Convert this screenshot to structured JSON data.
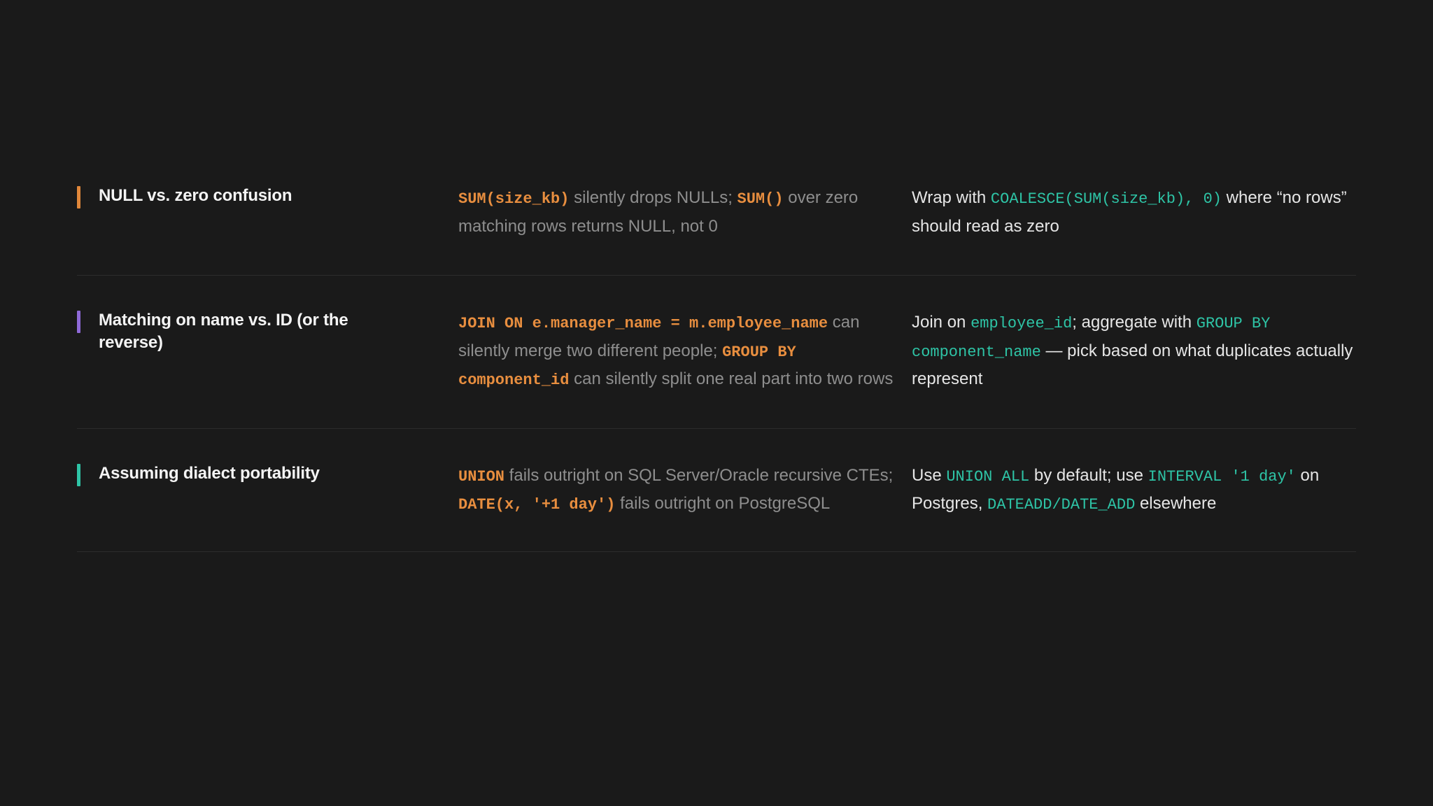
{
  "colors": {
    "background": "#1a1a1a",
    "divider": "#2c2c2c",
    "problem_code": "#e88e3f",
    "fix_code": "#2ec4a6",
    "problem_text": "#8e8e8e",
    "fix_text": "#e6e6e6"
  },
  "rows": [
    {
      "label": "NULL vs. zero confusion",
      "accent": "#e0873a",
      "problem": [
        {
          "t": "code",
          "v": "SUM(size_kb)"
        },
        {
          "t": "text",
          "v": " silently drops NULLs; "
        },
        {
          "t": "code",
          "v": "SUM()"
        },
        {
          "t": "text",
          "v": " over zero matching rows returns NULL, not 0"
        }
      ],
      "fix": [
        {
          "t": "text",
          "v": "Wrap with "
        },
        {
          "t": "code",
          "v": "COALESCE(SUM(size_kb), 0)"
        },
        {
          "t": "text",
          "v": " where “no rows” should read as zero"
        }
      ]
    },
    {
      "label": "Matching on name vs. ID (or the reverse)",
      "accent": "#8f6ad8",
      "problem": [
        {
          "t": "code",
          "v": "JOIN ON e.manager_name = m.employee_name"
        },
        {
          "t": "text",
          "v": " can silently merge two different people; "
        },
        {
          "t": "code",
          "v": "GROUP BY component_id"
        },
        {
          "t": "text",
          "v": " can silently split one real part into two rows"
        }
      ],
      "fix": [
        {
          "t": "text",
          "v": "Join on "
        },
        {
          "t": "code",
          "v": "employee_id"
        },
        {
          "t": "text",
          "v": "; aggregate with "
        },
        {
          "t": "code",
          "v": "GROUP BY component_name"
        },
        {
          "t": "text",
          "v": " — pick based on what duplicates actually represent"
        }
      ]
    },
    {
      "label": "Assuming dialect portability",
      "accent": "#2ec4a6",
      "problem": [
        {
          "t": "code",
          "v": "UNION"
        },
        {
          "t": "text",
          "v": " fails outright on SQL Server/Oracle recursive CTEs; "
        },
        {
          "t": "code",
          "v": "DATE(x, '+1 day')"
        },
        {
          "t": "text",
          "v": " fails outright on PostgreSQL"
        }
      ],
      "fix": [
        {
          "t": "text",
          "v": "Use "
        },
        {
          "t": "code",
          "v": "UNION ALL"
        },
        {
          "t": "text",
          "v": " by default; use "
        },
        {
          "t": "code",
          "v": "INTERVAL '1 day'"
        },
        {
          "t": "text",
          "v": " on Postgres, "
        },
        {
          "t": "code",
          "v": "DATEADD/DATE_ADD"
        },
        {
          "t": "text",
          "v": " elsewhere"
        }
      ]
    }
  ]
}
